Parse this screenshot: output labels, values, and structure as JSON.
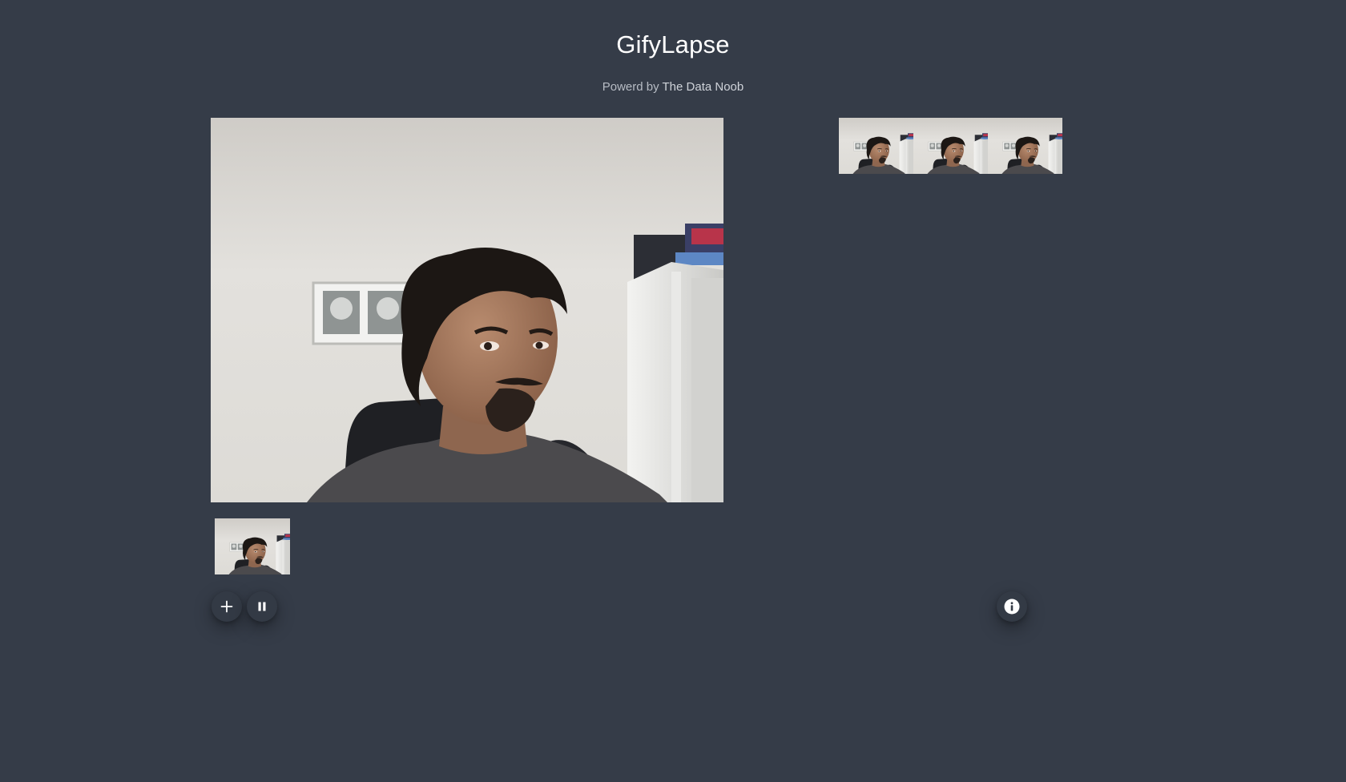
{
  "header": {
    "title": "GifyLapse",
    "subtitle_prefix": "Powerd by",
    "subtitle_brand": "The Data Noob"
  },
  "main_feed": {
    "alt": "webcam live feed"
  },
  "captured_frames": {
    "count": 3
  },
  "controls": {
    "add_icon": "plus-icon",
    "pause_icon": "pause-icon",
    "info_icon": "info-icon"
  },
  "colors": {
    "background": "#353c48",
    "button_bg": "#333a45",
    "title": "#ffffff",
    "subtitle": "#b7bcc4"
  }
}
